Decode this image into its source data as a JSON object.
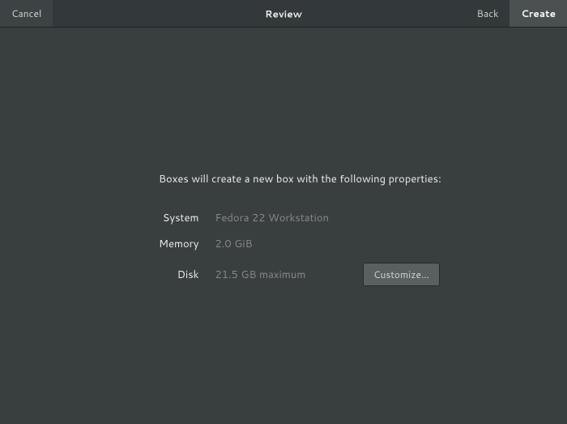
{
  "header": {
    "cancel": "Cancel",
    "title": "Review",
    "back": "Back",
    "create": "Create"
  },
  "main": {
    "intro": "Boxes will create a new box with the following properties:",
    "rows": [
      {
        "label": "System",
        "value": "Fedora 22 Workstation"
      },
      {
        "label": "Memory",
        "value": "2.0 GiB"
      },
      {
        "label": "Disk",
        "value": "21.5 GB maximum"
      }
    ],
    "customize": "Customize…"
  }
}
